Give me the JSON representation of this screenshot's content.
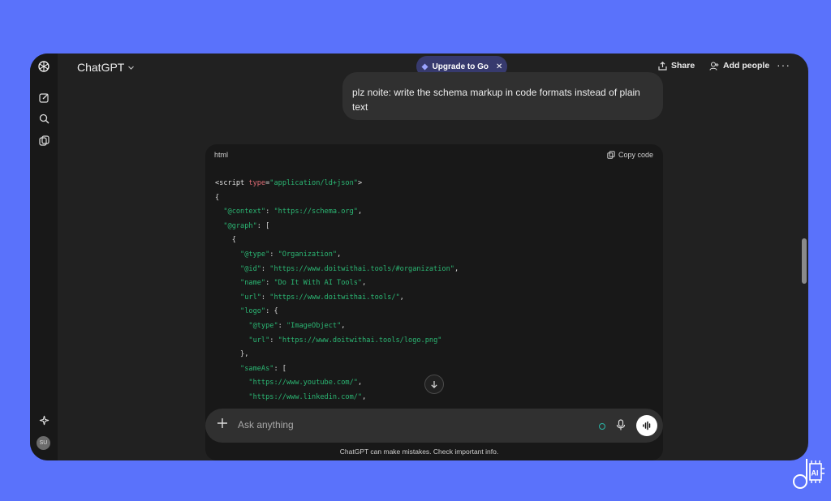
{
  "header": {
    "app_title": "ChatGPT",
    "upgrade_label": "Upgrade to Go",
    "share_label": "Share",
    "add_people_label": "Add people",
    "more_label": "···"
  },
  "rail": {
    "icons": [
      "new-chat-icon",
      "search-icon",
      "library-icon",
      "sparkle-icon"
    ],
    "avatar_initials": "SU"
  },
  "user_message": {
    "text": "plz noite: write the schema markup in code formats instead of plain text"
  },
  "code_block": {
    "language": "html",
    "copy_label": "Copy code",
    "lines": [
      "<script type=\"application/ld+json\">",
      "{",
      "  \"@context\": \"https://schema.org\",",
      "  \"@graph\": [",
      "    {",
      "      \"@type\": \"Organization\",",
      "      \"@id\": \"https://www.doitwithai.tools/#organization\",",
      "      \"name\": \"Do It With AI Tools\",",
      "      \"url\": \"https://www.doitwithai.tools/\",",
      "      \"logo\": {",
      "        \"@type\": \"ImageObject\",",
      "        \"url\": \"https://www.doitwithai.tools/logo.png\"",
      "      },",
      "      \"sameAs\": [",
      "        \"https://www.youtube.com/\",",
      "        \"https://www.linkedin.com/\","
    ]
  },
  "composer": {
    "placeholder": "Ask anything"
  },
  "footer": {
    "disclaimer": "ChatGPT can make mistakes. Check important info."
  },
  "colors": {
    "background": "#5a72fb",
    "window": "#212121",
    "upgrade_pill": "#373a6e",
    "string": "#2bb673",
    "attribute": "#e06c75"
  },
  "watermark": {
    "text": "AI"
  }
}
